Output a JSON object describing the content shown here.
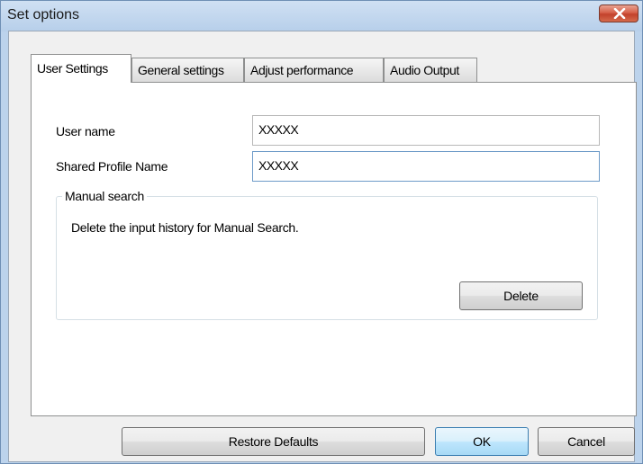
{
  "window": {
    "title": "Set options"
  },
  "tabs": [
    {
      "label": "User Settings",
      "active": true
    },
    {
      "label": "General settings",
      "active": false
    },
    {
      "label": "Adjust performance",
      "active": false
    },
    {
      "label": "Audio Output",
      "active": false
    }
  ],
  "user_settings": {
    "user_name_label": "User name",
    "user_name_value": "XXXXX",
    "shared_profile_label": "Shared Profile Name",
    "shared_profile_value": "XXXXX"
  },
  "manual_search": {
    "group_label": "Manual search",
    "description": "Delete the input history for Manual Search.",
    "delete_label": "Delete"
  },
  "footer": {
    "restore_label": "Restore Defaults",
    "ok_label": "OK",
    "cancel_label": "Cancel"
  },
  "colors": {
    "title_bar": "#bcd3ec",
    "close_button": "#c2412b",
    "default_button": "#3c7fb1"
  },
  "icons": {
    "close": "close-icon"
  }
}
